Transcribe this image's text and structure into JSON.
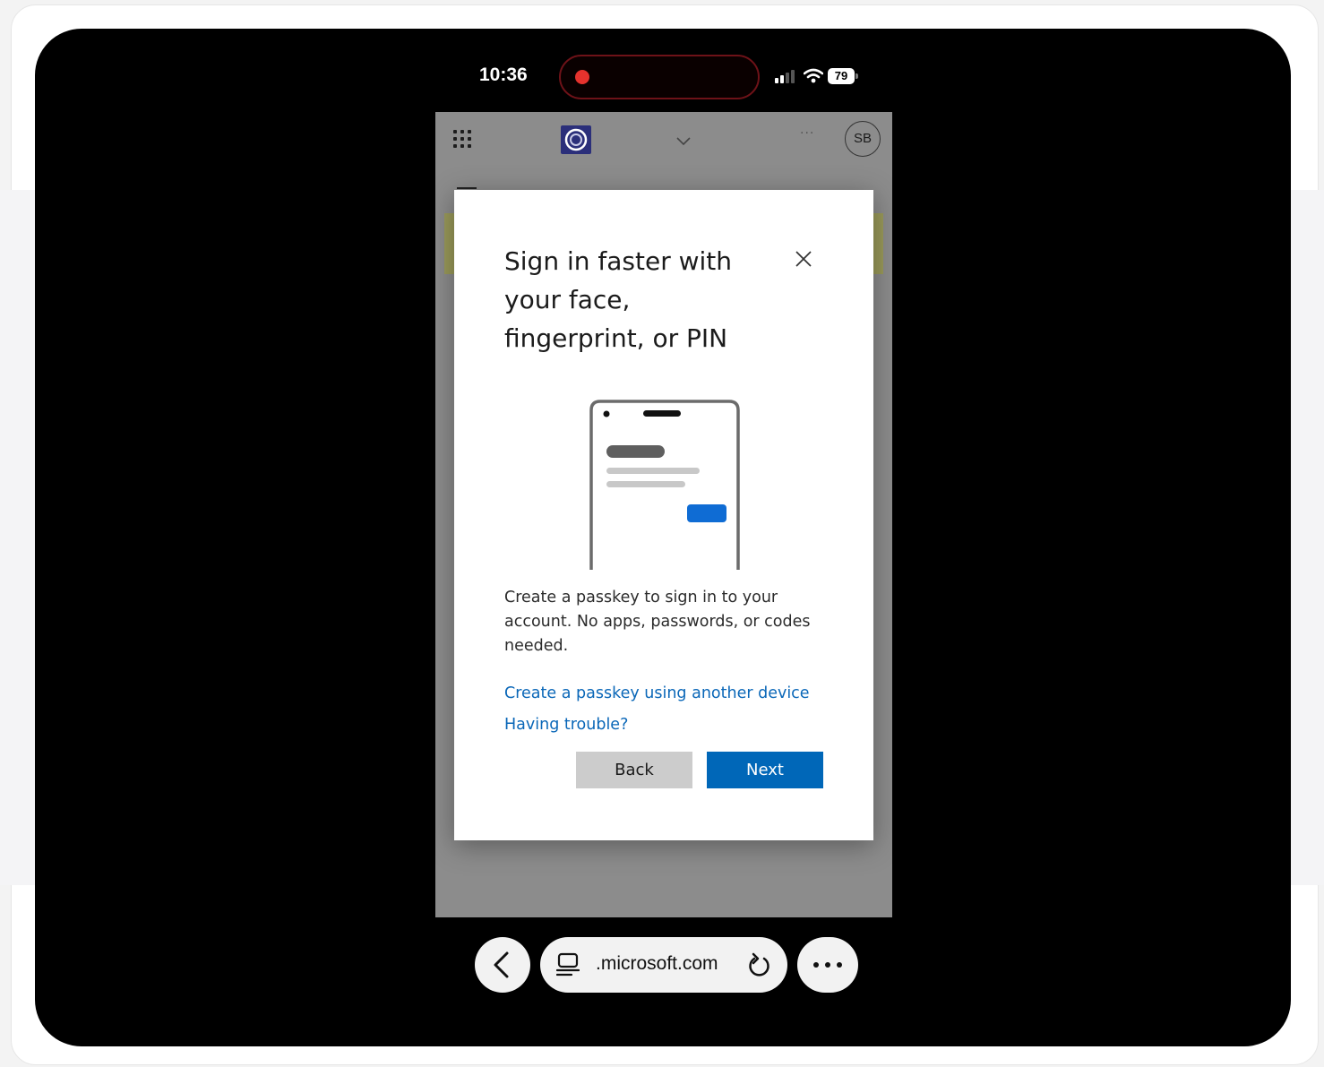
{
  "status_bar": {
    "time": "10:36",
    "battery": "79",
    "recording_indicator_color": "#e5322d"
  },
  "site_header": {
    "avatar_initials": "SB",
    "icons": [
      "app-launcher-grid-icon",
      "org-logo-icon",
      "chevron-down-icon",
      "ellipsis-icon"
    ]
  },
  "dialog": {
    "title": "Sign in faster with your face, fingerprint, or PIN",
    "description": "Create a passkey to sign in to your account. No apps, passwords, or codes needed.",
    "link_another_device": "Create a passkey using another device",
    "link_trouble": "Having trouble?",
    "back_label": "Back",
    "next_label": "Next",
    "accent_color": "#0067b8",
    "link_color": "#0a67b8"
  },
  "browser_bar": {
    "url": ".microsoft.com",
    "icons": [
      "back-arrow-icon",
      "tabs-icon",
      "reload-icon",
      "more-icon"
    ]
  }
}
